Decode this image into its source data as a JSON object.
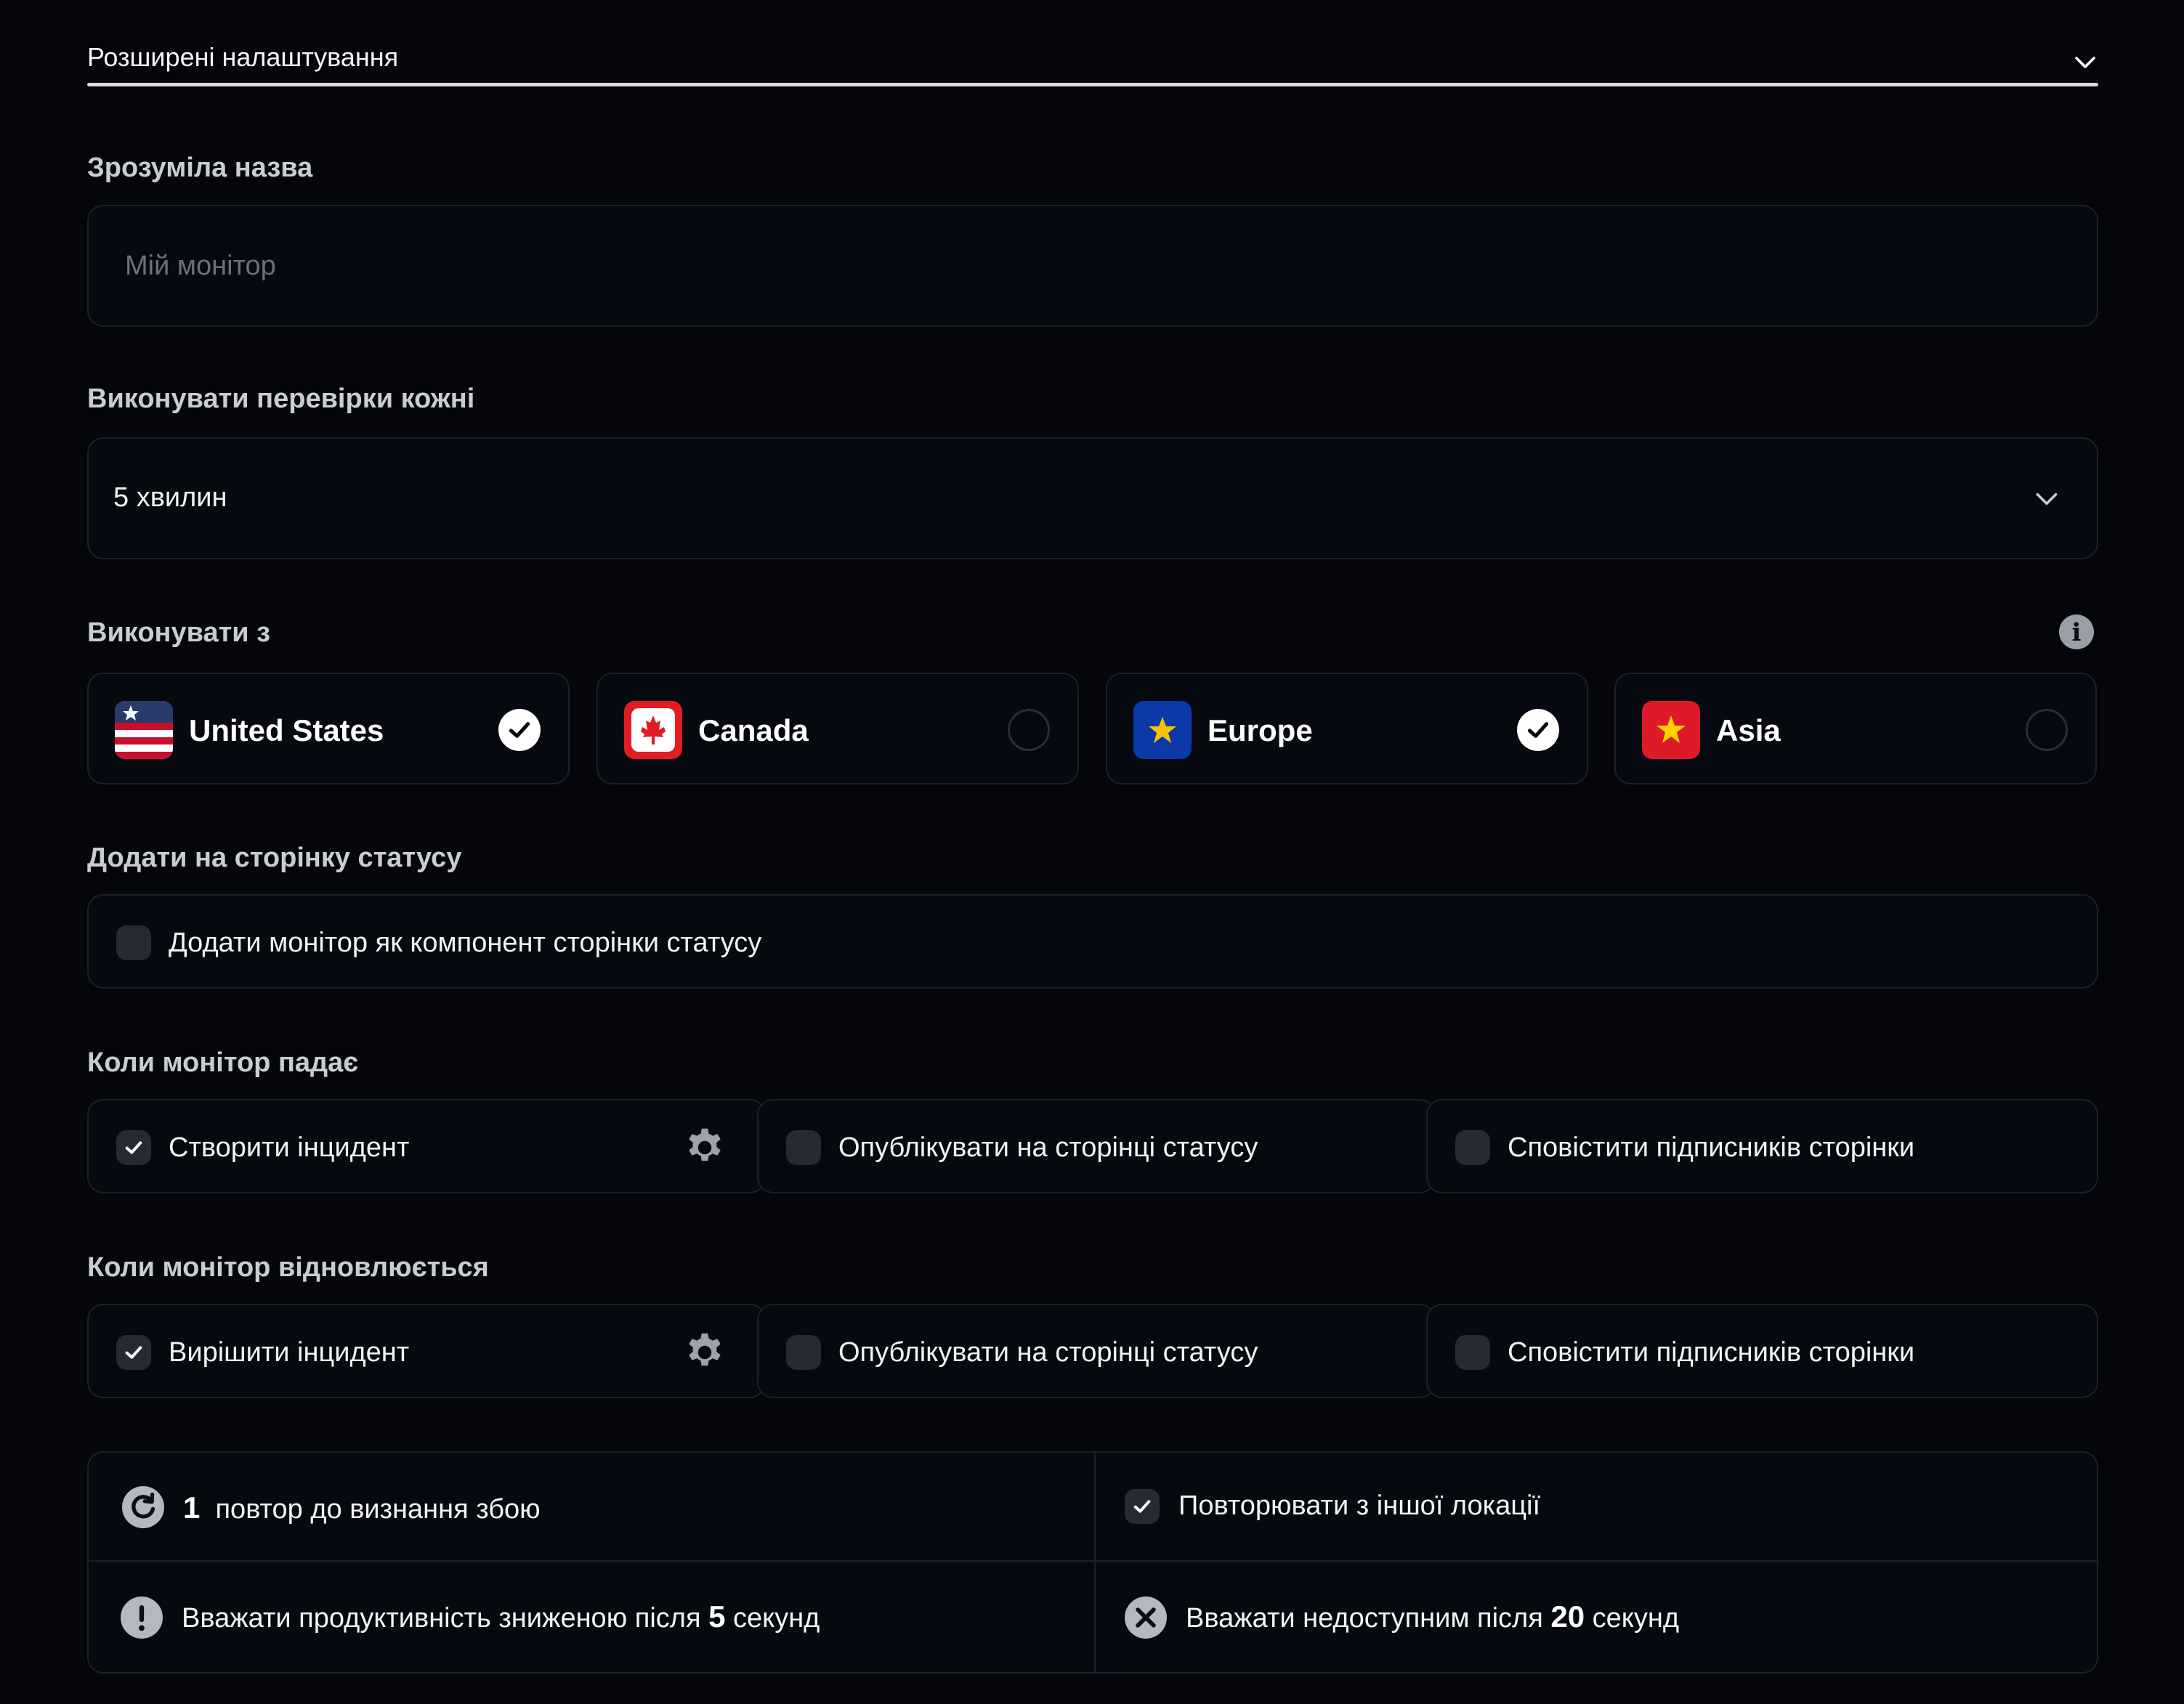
{
  "advanced": {
    "title": "Розширені налаштування"
  },
  "friendly_name": {
    "label": "Зрозуміла назва",
    "placeholder": "Мій монітор",
    "value": ""
  },
  "check_interval": {
    "label": "Виконувати перевірки кожні",
    "value": "5 хвилин"
  },
  "regions": {
    "label": "Виконувати з",
    "items": [
      {
        "name": "United States",
        "selected": true
      },
      {
        "name": "Canada",
        "selected": false
      },
      {
        "name": "Europe",
        "selected": true
      },
      {
        "name": "Asia",
        "selected": false
      }
    ]
  },
  "status_page": {
    "label": "Додати на сторінку статусу",
    "option": "Додати монітор як компонент сторінки статусу",
    "checked": false
  },
  "on_down": {
    "label": "Коли монітор падає",
    "create_incident": "Створити інцидент",
    "publish": "Опублікувати на сторінці статусу",
    "notify": "Сповістити підписників сторінки"
  },
  "on_recover": {
    "label": "Коли монітор відновлюється",
    "resolve_incident": "Вирішити інцидент",
    "publish": "Опублікувати на сторінці статусу",
    "notify": "Сповістити підписників сторінки"
  },
  "thresholds": {
    "retries": {
      "count": "1",
      "text": "повтор до визнання збою"
    },
    "retry_other_location": "Повторювати з іншої локації",
    "degraded": {
      "before": "Вважати продуктивність зниженою після",
      "value": "5",
      "unit": "секунд"
    },
    "down": {
      "before": "Вважати недоступним після",
      "value": "20",
      "unit": "секунд"
    }
  }
}
